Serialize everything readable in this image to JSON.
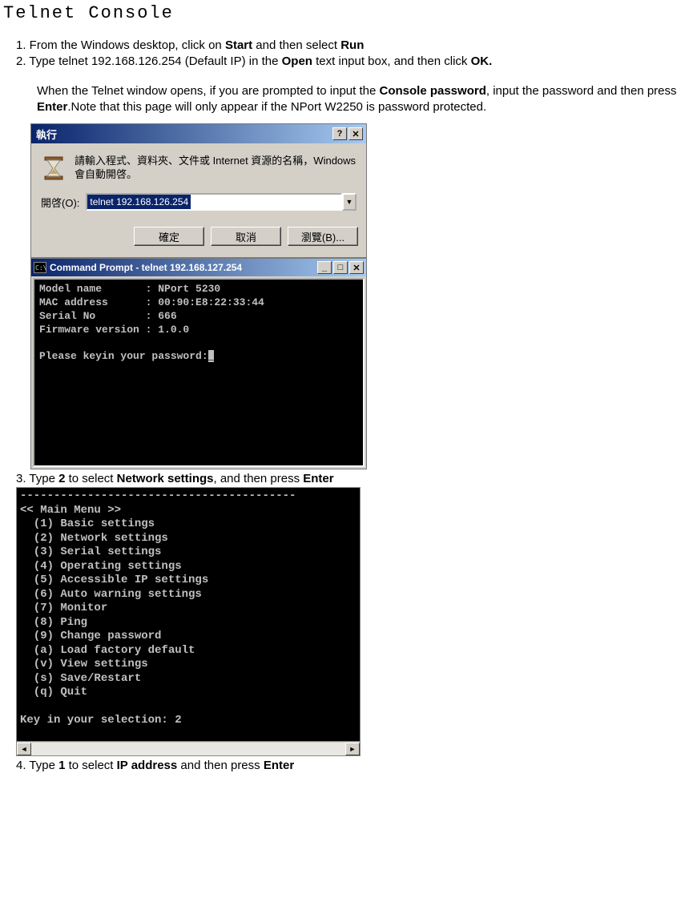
{
  "title": "Telnet Console",
  "step1": {
    "prefix": "1. From the Windows desktop, click on ",
    "bold1": "Start",
    "mid": " and then select ",
    "bold2": "Run"
  },
  "step2": {
    "prefix": "2. Type telnet 192.168.126.254 (Default IP) in the ",
    "bold1": "Open",
    "mid": " text input box, and then click ",
    "bold2": "OK."
  },
  "paragraph": {
    "t1": "When the Telnet window opens, if you are prompted to input the ",
    "b1": "Console password",
    "t2": ", input the password and then press ",
    "b2": "Enter",
    "t3": ".Note that this page will only appear if the NPort W2250 is password protected."
  },
  "run_dialog": {
    "title": "執行",
    "message": "請輸入程式、資料夾、文件或 Internet 資源的名稱，Windows會自動開啓。",
    "open_label": "開啓(O):",
    "input_value": "telnet 192.168.126.254",
    "ok": "確定",
    "cancel": "取消",
    "browse": "瀏覽(B)...",
    "help_glyph": "?",
    "close_glyph": "✕"
  },
  "cmd_window": {
    "title": "Command Prompt - telnet 192.168.127.254",
    "icon_text": "C:\\",
    "lines": {
      "model": "Model name       : NPort 5230",
      "mac": "MAC address      : 00:90:E8:22:33:44",
      "serial": "Serial No        : 666",
      "firmware": "Firmware version : 1.0.0",
      "blank": "",
      "prompt": "Please keyin your password:"
    },
    "min_glyph": "_",
    "max_glyph": "□",
    "close_glyph": "✕"
  },
  "step3": {
    "prefix": "3. Type ",
    "bold1": "2",
    "mid": " to select ",
    "bold2": "Network settings",
    "suffix": ", and then press ",
    "bold3": "Enter"
  },
  "menu_window": {
    "rule": "-----------------------------------------",
    "header": "<< Main Menu >>",
    "items": [
      "  (1) Basic settings",
      "  (2) Network settings",
      "  (3) Serial settings",
      "  (4) Operating settings",
      "  (5) Accessible IP settings",
      "  (6) Auto warning settings",
      "  (7) Monitor",
      "  (8) Ping",
      "  (9) Change password",
      "  (a) Load factory default",
      "  (v) View settings",
      "  (s) Save/Restart",
      "  (q) Quit"
    ],
    "prompt": "Key in your selection: 2",
    "left_glyph": "◄",
    "right_glyph": "►"
  },
  "step4": {
    "prefix": "4. Type ",
    "bold1": "1",
    "mid": " to select ",
    "bold2": "IP address",
    "suffix": " and then press ",
    "bold3": "Enter"
  },
  "chart_data": {
    "type": "table",
    "title": "Telnet device info",
    "rows": [
      {
        "field": "Model name",
        "value": "NPort 5230"
      },
      {
        "field": "MAC address",
        "value": "00:90:E8:22:33:44"
      },
      {
        "field": "Serial No",
        "value": "666"
      },
      {
        "field": "Firmware version",
        "value": "1.0.0"
      }
    ]
  }
}
